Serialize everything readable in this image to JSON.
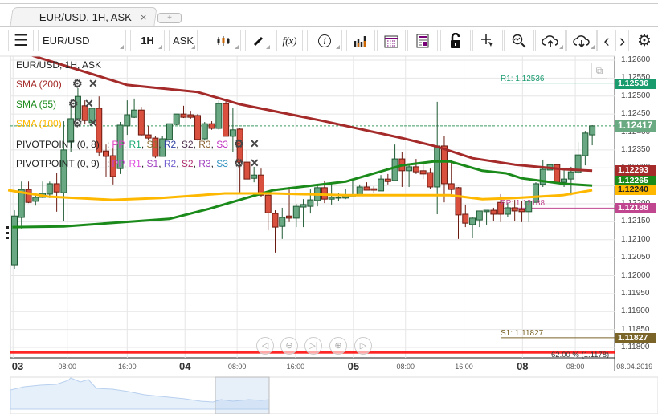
{
  "tab": {
    "title": "EUR/USD, 1H, ASK",
    "close": "×",
    "new": "+"
  },
  "toolbar": {
    "menu": "☰",
    "symbol": "EUR/USD",
    "timeframe": "1H",
    "side": "ASK",
    "fx": "f(x)",
    "info": "i",
    "prev": "‹",
    "next": "›"
  },
  "legend": {
    "title": "EUR/USD, 1H, ASK",
    "sma200": "SMA (200)",
    "sma55": "SMA (55)",
    "sma100": "SMA (100)",
    "pivot8": "PIVOTPOINT (0, 8)",
    "pivot9": "PIVOTPOINT (0, 9)",
    "pivot8_parts": [
      {
        "t": "PP",
        "c": "#e040c0"
      },
      {
        "t": "R1",
        "c": "#1aaa70"
      },
      {
        "t": "S1",
        "c": "#8a7030"
      },
      {
        "t": "R2",
        "c": "#3040a0"
      },
      {
        "t": "S2",
        "c": "#503050"
      },
      {
        "t": "R3",
        "c": "#8a6030"
      },
      {
        "t": "S3",
        "c": "#c030c0"
      }
    ],
    "pivot9_parts": [
      {
        "t": "PP",
        "c": "#c040d0"
      },
      {
        "t": "R1",
        "c": "#e050e0"
      },
      {
        "t": "S1",
        "c": "#a040c0"
      },
      {
        "t": "R2",
        "c": "#7060d0"
      },
      {
        "t": "S2",
        "c": "#b03070"
      },
      {
        "t": "R3",
        "c": "#a040c0"
      },
      {
        "t": "S3",
        "c": "#3090c0"
      }
    ],
    "sep": ":"
  },
  "colors": {
    "up": "#6aa884",
    "down": "#d9503f",
    "sma200": "#a52a2a",
    "sma55": "#1a8a1a",
    "sma100": "#ffb800",
    "r1": "#1a9b6e",
    "pp": "#c0478f",
    "s1": "#7a6428",
    "fib": "#ff0000"
  },
  "chart_data": {
    "type": "candlestick",
    "symbol": "EUR/USD",
    "timeframe": "1H",
    "ylim": [
      1.1176,
      1.1262
    ],
    "yticks": [
      "1.12600",
      "1.12550",
      "1.12500",
      "1.12450",
      "1.12400",
      "1.12350",
      "1.12300",
      "1.12250",
      "1.12200",
      "1.12150",
      "1.12100",
      "1.12050",
      "1.12000",
      "1.11950",
      "1.11900",
      "1.11850",
      "1.11800"
    ],
    "xticks": [
      {
        "i": -0.2,
        "t": "03",
        "major": true
      },
      {
        "i": 7.5,
        "t": "08:00"
      },
      {
        "i": 16,
        "t": "16:00"
      },
      {
        "i": 24.2,
        "t": "04",
        "major": true
      },
      {
        "i": 31.6,
        "t": "08:00"
      },
      {
        "i": 39.9,
        "t": "16:00"
      },
      {
        "i": 48.1,
        "t": "05",
        "major": true
      },
      {
        "i": 55.5,
        "t": "08:00"
      },
      {
        "i": 63.8,
        "t": "16:00"
      },
      {
        "i": 72.1,
        "t": "08",
        "major": true
      },
      {
        "i": 79.6,
        "t": "08:00"
      },
      {
        "i": 88,
        "t": "08.04.2019"
      }
    ],
    "ohlc": [
      [
        1.1203,
        1.12182,
        1.12019,
        1.12166
      ],
      [
        1.12162,
        1.12262,
        1.12131,
        1.1224
      ],
      [
        1.1224,
        1.12262,
        1.12202,
        1.12204
      ],
      [
        1.12207,
        1.12227,
        1.12195,
        1.12218
      ],
      [
        1.12218,
        1.12262,
        1.12216,
        1.12229
      ],
      [
        1.12227,
        1.12262,
        1.12216,
        1.12256
      ],
      [
        1.12256,
        1.12285,
        1.12178,
        1.12233
      ],
      [
        1.12231,
        1.1243,
        1.12153,
        1.1235
      ],
      [
        1.12372,
        1.12477,
        1.12343,
        1.12437
      ],
      [
        1.12437,
        1.12522,
        1.12432,
        1.12499
      ],
      [
        1.12473,
        1.12488,
        1.12421,
        1.12432
      ],
      [
        1.12426,
        1.12499,
        1.1241,
        1.12466
      ],
      [
        1.12466,
        1.12499,
        1.12332,
        1.12343
      ],
      [
        1.12347,
        1.12365,
        1.12276,
        1.12332
      ],
      [
        1.12334,
        1.12354,
        1.12254,
        1.12276
      ],
      [
        1.12298,
        1.12428,
        1.12283,
        1.12419
      ],
      [
        1.12417,
        1.12488,
        1.12392,
        1.12448
      ],
      [
        1.12441,
        1.12493,
        1.12439,
        1.12461
      ],
      [
        1.12461,
        1.1247,
        1.12388,
        1.12392
      ],
      [
        1.12392,
        1.12417,
        1.12376,
        1.12383
      ],
      [
        1.12383,
        1.12388,
        1.12327,
        1.12332
      ],
      [
        1.12332,
        1.12388,
        1.12332,
        1.12381
      ],
      [
        1.12379,
        1.12423,
        1.12379,
        1.12423
      ],
      [
        1.12421,
        1.1245,
        1.12419,
        1.1245
      ],
      [
        1.1245,
        1.12473,
        1.12439,
        1.12441
      ],
      [
        1.12448,
        1.12459,
        1.12437,
        1.12441
      ],
      [
        1.12446,
        1.1245,
        1.12376,
        1.12379
      ],
      [
        1.12381,
        1.12428,
        1.12376,
        1.12423
      ],
      [
        1.12423,
        1.1243,
        1.12406,
        1.1241
      ],
      [
        1.1241,
        1.12488,
        1.12406,
        1.12479
      ],
      [
        1.12479,
        1.12488,
        1.12388,
        1.12388
      ],
      [
        1.12388,
        1.12468,
        1.12343,
        1.12406
      ],
      [
        1.12408,
        1.1241,
        1.12227,
        1.12316
      ],
      [
        1.12316,
        1.1235,
        1.12269,
        1.12269
      ],
      [
        1.12271,
        1.12303,
        1.1226,
        1.1228
      ],
      [
        1.1228,
        1.12298,
        1.1222,
        1.12224
      ],
      [
        1.12224,
        1.12238,
        1.12126,
        1.12175
      ],
      [
        1.12173,
        1.12182,
        1.12064,
        1.12135
      ],
      [
        1.12137,
        1.12189,
        1.12102,
        1.12162
      ],
      [
        1.12166,
        1.12247,
        1.12149,
        1.1216
      ],
      [
        1.1216,
        1.122,
        1.12135,
        1.12193
      ],
      [
        1.12191,
        1.12213,
        1.12135,
        1.12198
      ],
      [
        1.12193,
        1.1224,
        1.12173,
        1.12211
      ],
      [
        1.12209,
        1.12254,
        1.12193,
        1.12245
      ],
      [
        1.12245,
        1.12265,
        1.12202,
        1.12213
      ],
      [
        1.12213,
        1.1226,
        1.12198,
        1.12218
      ],
      [
        1.12216,
        1.12231,
        1.12207,
        1.12218
      ],
      [
        1.12216,
        1.12242,
        1.12213,
        1.12224
      ],
      [
        1.12224,
        1.12265,
        1.12222,
        1.12224
      ],
      [
        1.12224,
        1.12254,
        1.12222,
        1.12247
      ],
      [
        1.12247,
        1.1226,
        1.12238,
        1.12238
      ],
      [
        1.12242,
        1.12249,
        1.12229,
        1.12238
      ],
      [
        1.12236,
        1.1228,
        1.12236,
        1.12269
      ],
      [
        1.12269,
        1.12283,
        1.12254,
        1.12262
      ],
      [
        1.12265,
        1.12365,
        1.12265,
        1.12325
      ],
      [
        1.12325,
        1.12343,
        1.12247,
        1.12292
      ],
      [
        1.12292,
        1.12309,
        1.12247,
        1.12303
      ],
      [
        1.12303,
        1.12325,
        1.12283,
        1.12289
      ],
      [
        1.12292,
        1.12314,
        1.12269,
        1.12283
      ],
      [
        1.12287,
        1.12298,
        1.12242,
        1.12247
      ],
      [
        1.12247,
        1.12484,
        1.12171,
        1.12361
      ],
      [
        1.12361,
        1.12388,
        1.12204,
        1.12256
      ],
      [
        1.12256,
        1.12321,
        1.12227,
        1.1224
      ],
      [
        1.12245,
        1.12247,
        1.12102,
        1.12169
      ],
      [
        1.12171,
        1.12198,
        1.12135,
        1.12146
      ],
      [
        1.12142,
        1.12162,
        1.12104,
        1.1216
      ],
      [
        1.12155,
        1.1218,
        1.12135,
        1.1218
      ],
      [
        1.12178,
        1.12182,
        1.12142,
        1.12182
      ],
      [
        1.12182,
        1.12189,
        1.12151,
        1.12171
      ],
      [
        1.12204,
        1.12227,
        1.12149,
        1.12171
      ],
      [
        1.12171,
        1.12202,
        1.12164,
        1.12189
      ],
      [
        1.12189,
        1.12211,
        1.12153,
        1.1218
      ],
      [
        1.12184,
        1.12207,
        1.12149,
        1.12178
      ],
      [
        1.12178,
        1.12211,
        1.12149,
        1.12207
      ],
      [
        1.12204,
        1.1226,
        1.12204,
        1.12256
      ],
      [
        1.12254,
        1.12323,
        1.12247,
        1.12296
      ],
      [
        1.12294,
        1.12312,
        1.12292,
        1.12309
      ],
      [
        1.12309,
        1.12309,
        1.12258,
        1.1226
      ],
      [
        1.1226,
        1.12294,
        1.12247,
        1.12269
      ],
      [
        1.12269,
        1.12303,
        1.12224,
        1.12289
      ],
      [
        1.12287,
        1.12372,
        1.12283,
        1.12336
      ],
      [
        1.12334,
        1.12403,
        1.12307,
        1.12397
      ],
      [
        1.12392,
        1.12419,
        1.12363,
        1.12417
      ]
    ],
    "sma200": [
      [
        2,
        1.12616
      ],
      [
        16,
        1.12531
      ],
      [
        26,
        1.12511
      ],
      [
        32,
        1.12477
      ],
      [
        43.5,
        1.12432
      ],
      [
        55,
        1.12383
      ],
      [
        60,
        1.12359
      ],
      [
        65,
        1.12327
      ],
      [
        71,
        1.12309
      ],
      [
        78,
        1.12296
      ],
      [
        82,
        1.12292
      ]
    ],
    "sma55": [
      [
        -0.3,
        1.12135
      ],
      [
        7,
        1.12137
      ],
      [
        22,
        1.12158
      ],
      [
        27.6,
        1.12186
      ],
      [
        36.7,
        1.12238
      ],
      [
        47,
        1.12262
      ],
      [
        55,
        1.12307
      ],
      [
        59.5,
        1.12318
      ],
      [
        61.8,
        1.12318
      ],
      [
        66.4,
        1.12292
      ],
      [
        69.8,
        1.12285
      ],
      [
        72,
        1.12271
      ],
      [
        77.8,
        1.12256
      ],
      [
        82,
        1.12251
      ]
    ],
    "sma100": [
      [
        -0.9,
        1.12238
      ],
      [
        4.8,
        1.1222
      ],
      [
        13.9,
        1.12211
      ],
      [
        20.8,
        1.12216
      ],
      [
        29.9,
        1.12229
      ],
      [
        36.7,
        1.12229
      ],
      [
        47,
        1.12224
      ],
      [
        55,
        1.12224
      ],
      [
        61.8,
        1.12224
      ],
      [
        66.4,
        1.12213
      ],
      [
        71,
        1.12216
      ],
      [
        77.8,
        1.12224
      ],
      [
        82,
        1.12238
      ]
    ],
    "levels": {
      "r1": {
        "label": "R1: 1.12536",
        "value": 1.12536
      },
      "pp": {
        "label": "PP: 1.12188",
        "value": 1.12188
      },
      "s1": {
        "label": "S1: 1.11827",
        "value": 1.11827
      },
      "fib": {
        "label": "62.00 % (1.1178)",
        "value": 1.11785
      }
    },
    "badges": [
      {
        "t": "1.12536",
        "v": 1.12536,
        "c": "#1a9b6e"
      },
      {
        "t": "1.12417",
        "v": 1.12417,
        "c": "#6aaa82"
      },
      {
        "t": "1.12293",
        "v": 1.12293,
        "c": "#a52a2a"
      },
      {
        "t": "1.12265",
        "v": 1.12265,
        "c": "#1a8a1a"
      },
      {
        "t": "1.12240",
        "v": 1.1224,
        "c": "#ffb800",
        "dark": true
      },
      {
        "t": "1.12188",
        "v": 1.12188,
        "c": "#c0478f"
      },
      {
        "t": "1.11827",
        "v": 1.11827,
        "c": "#7a6428"
      }
    ],
    "last": 1.12417
  }
}
